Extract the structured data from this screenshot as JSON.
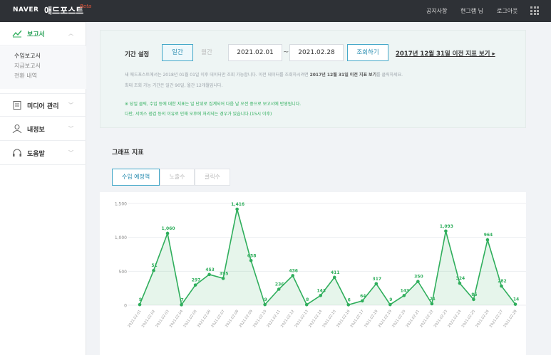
{
  "header": {
    "logo": "NAVER",
    "service": "애드포스트",
    "badge": "Beta",
    "nav": [
      "공지사항",
      "현그램 님",
      "로그아웃"
    ]
  },
  "sidebar": {
    "items": [
      {
        "label": "보고서",
        "icon": "chart-line-icon",
        "active": true
      },
      {
        "label": "미디어 관리",
        "icon": "document-icon"
      },
      {
        "label": "내정보",
        "icon": "user-icon"
      },
      {
        "label": "도움말",
        "icon": "headset-icon"
      }
    ],
    "submenu": [
      "수입보고서",
      "지급보고서",
      "전환 내역"
    ]
  },
  "period": {
    "label": "기간 설정",
    "daily": "일간",
    "monthly": "월간",
    "start_date": "2021.02.01",
    "end_date": "2021.02.28",
    "search_button": "조회하기",
    "prev_link": "2017년 12월 31일 이전 지표 보기",
    "note1_pre": "새 애드포스트에서는 2018년 01월 01일 이후 데이터만 조회 가능합니다. 이전 데이터를 조회하시려면 ",
    "note1_bold": "2017년 12월 31일 이전 지표 보기",
    "note1_post": "를 클릭하세요.",
    "note2": "최대 조회 가능 기간은 일간 90일, 월간 12개월입니다.",
    "note3": "※ 당일 클릭, 수입 등에 대한 지표는 일 단위로 집계되어 다음 날 오전 중으로 보고서에 반영됩니다.",
    "note4": "다만, 서비스 점검 등의 이유로 인해 오후에 처리되는 경우가 있습니다.(15시 이후)"
  },
  "graph": {
    "title": "그래프 지표",
    "tabs": [
      "수입 예정액",
      "노출수",
      "클릭수"
    ]
  },
  "colors": {
    "accent": "#2fae5c",
    "tab_active": "#45a8c9"
  },
  "chart_data": {
    "type": "area",
    "x": [
      "2021.02.01",
      "2021.02.02",
      "2021.02.03",
      "2021.02.04",
      "2021.02.05",
      "2021.02.06",
      "2021.02.07",
      "2021.02.08",
      "2021.02.09",
      "2021.02.10",
      "2021.02.11",
      "2021.02.12",
      "2021.02.13",
      "2021.02.14",
      "2021.02.15",
      "2021.02.16",
      "2021.02.17",
      "2021.02.18",
      "2021.02.19",
      "2021.02.20",
      "2021.02.21",
      "2021.02.22",
      "2021.02.23",
      "2021.02.24",
      "2021.02.25",
      "2021.02.26",
      "2021.02.27",
      "2021.02.28"
    ],
    "values": [
      9,
      512,
      1060,
      7,
      297,
      453,
      395,
      1416,
      658,
      9,
      236,
      436,
      8,
      143,
      411,
      6,
      64,
      317,
      9,
      143,
      350,
      21,
      1093,
      324,
      85,
      964,
      282,
      14
    ],
    "labels": [
      "9",
      "51",
      "1,060",
      "7",
      "297",
      "453",
      "395",
      "1,416",
      "658",
      "9",
      "236",
      "436",
      "8",
      "143",
      "411",
      "6",
      "64",
      "317",
      "9",
      "143",
      "350",
      "21",
      "1,093",
      "324",
      "85",
      "964",
      "282",
      "14"
    ],
    "yticks": [
      "1,500",
      "1,000",
      "500",
      "0"
    ],
    "ytick_values": [
      1500,
      1000,
      500,
      0
    ],
    "ylim": [
      0,
      1500
    ],
    "grid": true
  }
}
